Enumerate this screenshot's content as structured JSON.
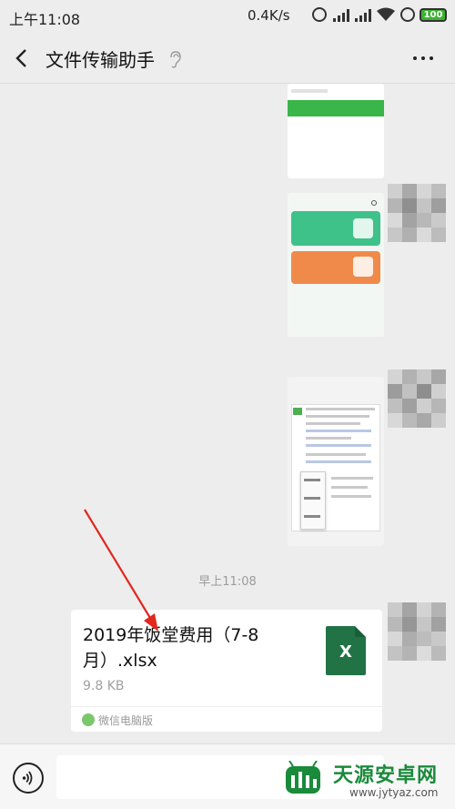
{
  "status_bar": {
    "time": "上午11:08",
    "net_speed": "0.4K/s",
    "battery": "100"
  },
  "nav": {
    "title": "文件传输助手"
  },
  "chat": {
    "timestamp": "早上11:08",
    "file_message": {
      "name": "2019年饭堂费用（7-8月）.xlsx",
      "size": "9.8 KB",
      "file_icon_letter": "X",
      "source": "微信电脑版"
    }
  },
  "watermark": {
    "text": "天源安卓网",
    "url": "www.jytyaz.com"
  },
  "colors": {
    "accent": "#217346",
    "arrow": "#e0281e",
    "brand": "#1a8a3b"
  }
}
